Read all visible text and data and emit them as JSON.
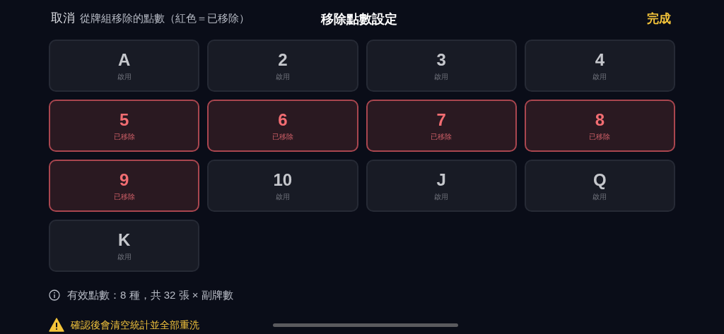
{
  "header": {
    "cancel": "取消",
    "hint": "從牌組移除的點數（紅色＝已移除）",
    "title": "移除點數設定",
    "done": "完成"
  },
  "ranks": [
    {
      "label": "A",
      "status": "啟用",
      "removed": false
    },
    {
      "label": "2",
      "status": "啟用",
      "removed": false
    },
    {
      "label": "3",
      "status": "啟用",
      "removed": false
    },
    {
      "label": "4",
      "status": "啟用",
      "removed": false
    },
    {
      "label": "5",
      "status": "已移除",
      "removed": true
    },
    {
      "label": "6",
      "status": "已移除",
      "removed": true
    },
    {
      "label": "7",
      "status": "已移除",
      "removed": true
    },
    {
      "label": "8",
      "status": "已移除",
      "removed": true
    },
    {
      "label": "9",
      "status": "已移除",
      "removed": true
    },
    {
      "label": "10",
      "status": "啟用",
      "removed": false
    },
    {
      "label": "J",
      "status": "啟用",
      "removed": false
    },
    {
      "label": "Q",
      "status": "啟用",
      "removed": false
    },
    {
      "label": "K",
      "status": "啟用",
      "removed": false
    }
  ],
  "info": "有效點數：8 種，共 32 張 × 副牌數",
  "warning": "確認後會清空統計並全部重洗"
}
